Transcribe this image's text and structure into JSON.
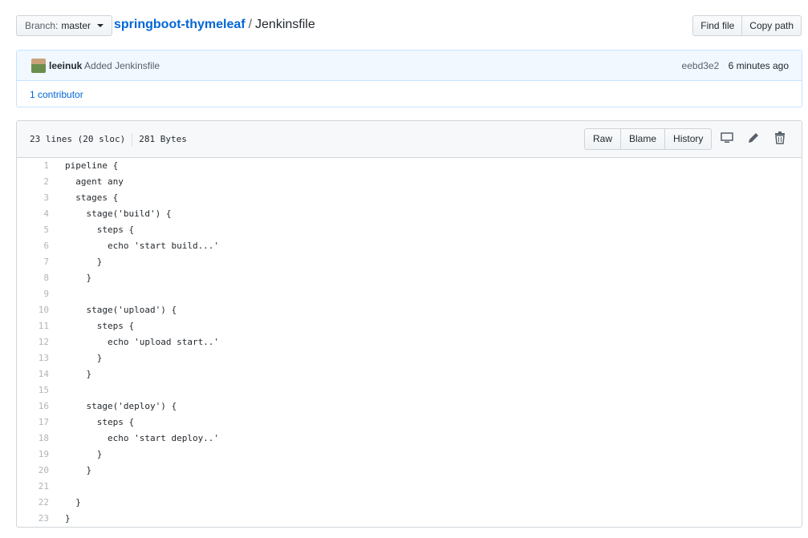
{
  "header": {
    "branch_prefix": "Branch:",
    "branch": "master",
    "repo": "springboot-thymeleaf",
    "separator": "/",
    "file": "Jenkinsfile",
    "find_file": "Find file",
    "copy_path": "Copy path"
  },
  "commit": {
    "author": "leeinuk",
    "message": "Added Jenkinsfile",
    "sha": "eebd3e2",
    "time": "6 minutes ago",
    "contributors": "1 contributor"
  },
  "file": {
    "lines_info": "23 lines (20 sloc)",
    "size": "281 Bytes",
    "raw": "Raw",
    "blame": "Blame",
    "history": "History",
    "icons": [
      "desktop-icon",
      "pencil-icon",
      "trash-icon"
    ]
  },
  "code": [
    {
      "n": "1",
      "t": "pipeline {"
    },
    {
      "n": "2",
      "t": "  agent any"
    },
    {
      "n": "3",
      "t": "  stages {"
    },
    {
      "n": "4",
      "t": "    stage('build') {"
    },
    {
      "n": "5",
      "t": "      steps {"
    },
    {
      "n": "6",
      "t": "        echo 'start build...'"
    },
    {
      "n": "7",
      "t": "      }"
    },
    {
      "n": "8",
      "t": "    }"
    },
    {
      "n": "9",
      "t": ""
    },
    {
      "n": "10",
      "t": "    stage('upload') {"
    },
    {
      "n": "11",
      "t": "      steps {"
    },
    {
      "n": "12",
      "t": "        echo 'upload start..'"
    },
    {
      "n": "13",
      "t": "      }"
    },
    {
      "n": "14",
      "t": "    }"
    },
    {
      "n": "15",
      "t": ""
    },
    {
      "n": "16",
      "t": "    stage('deploy') {"
    },
    {
      "n": "17",
      "t": "      steps {"
    },
    {
      "n": "18",
      "t": "        echo 'start deploy..'"
    },
    {
      "n": "19",
      "t": "      }"
    },
    {
      "n": "20",
      "t": "    }"
    },
    {
      "n": "21",
      "t": ""
    },
    {
      "n": "22",
      "t": "  }"
    },
    {
      "n": "23",
      "t": "}"
    }
  ]
}
